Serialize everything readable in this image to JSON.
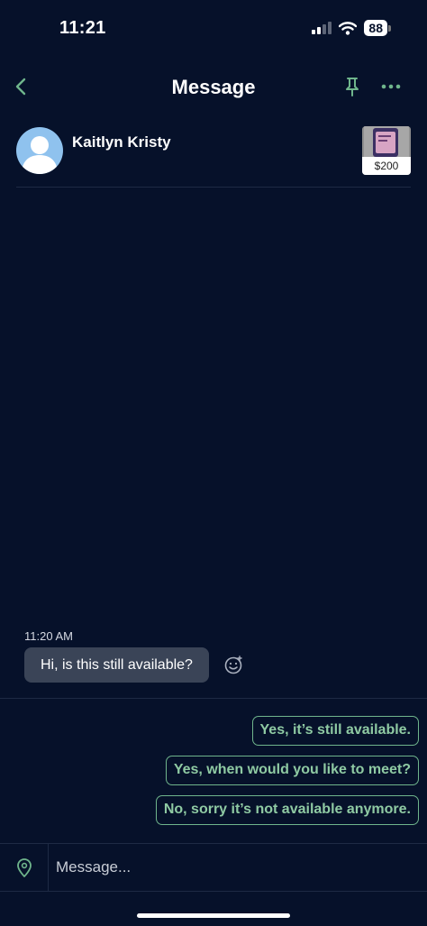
{
  "status_bar": {
    "time": "11:21",
    "battery": "88"
  },
  "header": {
    "title": "Message"
  },
  "contact": {
    "name": "Kaitlyn Kristy",
    "item_price": "$200"
  },
  "conversation": {
    "messages": [
      {
        "time": "11:20 AM",
        "text": "Hi, is this still available?"
      }
    ]
  },
  "quick_replies": [
    "Yes, it’s still available.",
    "Yes, when would you like to meet?",
    "No, sorry it’s not available anymore."
  ],
  "composer": {
    "placeholder": "Message..."
  },
  "colors": {
    "background": "#06112a",
    "accent": "#6fb58c",
    "bubble": "#3a4457",
    "avatar": "#8fc2ee"
  }
}
